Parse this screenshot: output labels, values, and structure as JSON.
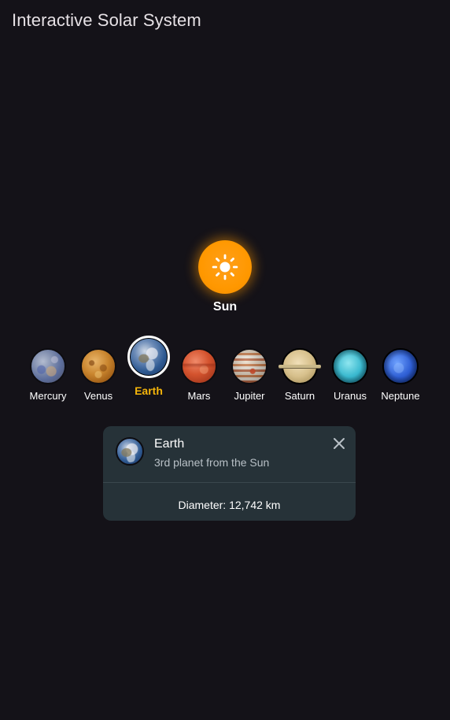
{
  "app": {
    "title": "Interactive Solar System"
  },
  "sun": {
    "label": "Sun",
    "icon": "sun-icon",
    "color": "#ff9800"
  },
  "planets": [
    {
      "name": "Mercury",
      "selected": false
    },
    {
      "name": "Venus",
      "selected": false
    },
    {
      "name": "Earth",
      "selected": true
    },
    {
      "name": "Mars",
      "selected": false
    },
    {
      "name": "Jupiter",
      "selected": false
    },
    {
      "name": "Saturn",
      "selected": false
    },
    {
      "name": "Uranus",
      "selected": false
    },
    {
      "name": "Neptune",
      "selected": false
    }
  ],
  "selected_color": "#f5b50a",
  "info_card": {
    "title": "Earth",
    "subtitle": "3rd planet from the Sun",
    "footer": "Diameter: 12,742 km",
    "close_icon": "close-icon",
    "background": "#263238"
  }
}
